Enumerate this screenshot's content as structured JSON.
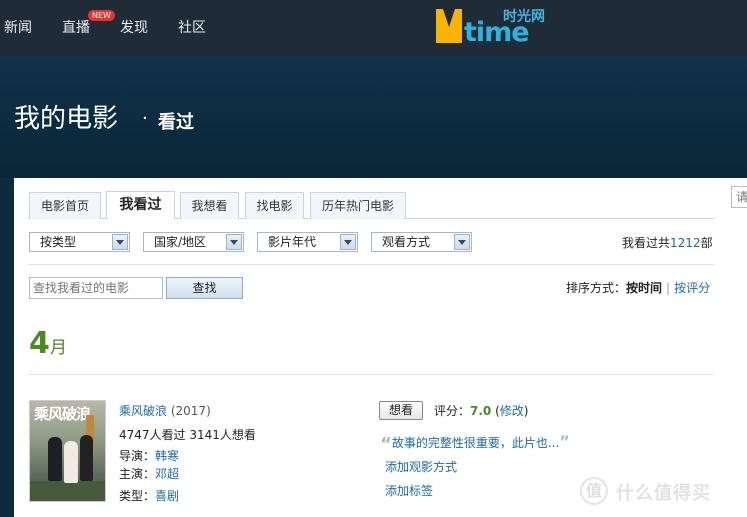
{
  "topnav": {
    "items": [
      "新闻",
      "直播",
      "发现",
      "社区"
    ],
    "new_badge": "NEW",
    "logo_text": "time",
    "logo_cn": "时光网"
  },
  "header": {
    "title": "我的电影",
    "dot": "·",
    "subtitle": "看过"
  },
  "right_search": {
    "placeholder": "请"
  },
  "tabs": [
    {
      "label": "电影首页"
    },
    {
      "label": "我看过",
      "active": true
    },
    {
      "label": "我想看"
    },
    {
      "label": "找电影"
    },
    {
      "label": "历年热门电影"
    }
  ],
  "filters": [
    {
      "label": "按类型"
    },
    {
      "label": "国家/地区"
    },
    {
      "label": "影片年代"
    },
    {
      "label": "观看方式"
    }
  ],
  "count": {
    "prefix": "我看过共",
    "number": "1212",
    "suffix": "部"
  },
  "search": {
    "placeholder": "查找我看过的电影",
    "button": "查找"
  },
  "sort": {
    "label": "排序方式：",
    "current": "按时间",
    "sep": "|",
    "alt": "按评分"
  },
  "month": {
    "number": "4",
    "unit": "月"
  },
  "movie": {
    "poster_title": "乘风破浪",
    "title": "乘风破浪",
    "year": "(2017)",
    "stats": "4747人看过 3141人想看",
    "director_label": "导演：",
    "director": "韩寒",
    "starring_label": "主演：",
    "starring": "邓超",
    "genre_label": "类型：",
    "genre": "喜剧",
    "want_button": "想看",
    "rating_label": "评分：",
    "rating": "7.0",
    "edit_link": "修改",
    "review_quote": "故事的完整性很重要，此片也...",
    "add_watch_method": "添加观影方式",
    "add_tag": "添加标签"
  },
  "watermark": {
    "icon": "值",
    "text": "什么值得买"
  },
  "colors": {
    "top_bar": "#1f2b36",
    "banner": "#0e2a3d",
    "link": "#1a6aa8",
    "accent_green": "#4a8a22",
    "logo_yellow": "#f7b400",
    "logo_blue": "#2db3e0"
  }
}
